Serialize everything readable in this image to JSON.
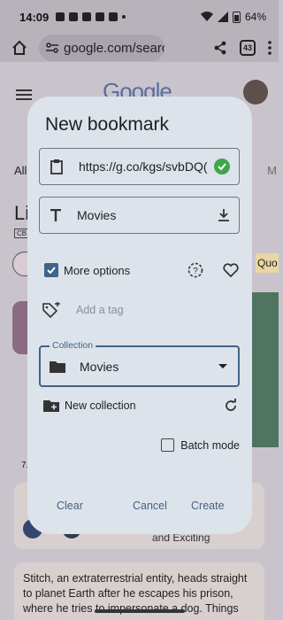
{
  "status_bar": {
    "time": "14:09",
    "battery": "64%"
  },
  "browser": {
    "url": "google.com/searc",
    "tab_count": "43"
  },
  "background": {
    "logo": "Google",
    "tab_all": "All",
    "tab_more": "M",
    "heading_partial": "Li",
    "rating_badge": "CB",
    "chip_partial": "Quo",
    "meta_partial": "7.",
    "card_partial": "and Exciting",
    "description": "Stitch, an extraterrestrial entity, heads straight to planet Earth after he escapes his prison, where he tries to impersonate a dog. Things"
  },
  "dialog": {
    "title": "New bookmark",
    "url_value": "https://g.co/kgs/svbDQ(",
    "title_value": "Movies",
    "more_options_label": "More options",
    "more_options_checked": true,
    "tag_placeholder": "Add a tag",
    "collection_legend": "Collection",
    "collection_value": "Movies",
    "new_collection_label": "New collection",
    "batch_mode_label": "Batch mode",
    "batch_mode_checked": false,
    "actions": {
      "clear": "Clear",
      "cancel": "Cancel",
      "create": "Create"
    }
  },
  "colors": {
    "accent": "#40638a",
    "success": "#3fa54a",
    "dialog_bg": "#dde3ea"
  }
}
